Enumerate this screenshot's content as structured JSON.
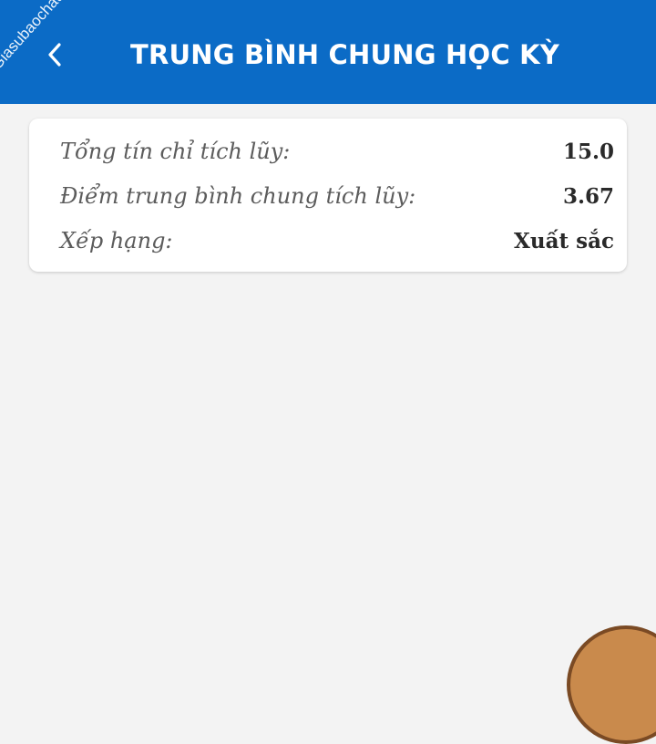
{
  "header": {
    "title": "TRUNG BÌNH CHUNG HỌC KỲ",
    "back_icon": "chevron-left-icon",
    "background": "#0b6bc6"
  },
  "watermark": {
    "text": "Giasubaochau.net"
  },
  "summary": {
    "rows": [
      {
        "label": "Tổng tín chỉ tích lũy:",
        "value": "15.0"
      },
      {
        "label": "Điểm trung bình chung tích lũy:",
        "value": "3.67"
      },
      {
        "label": "Xếp hạng:",
        "value": "Xuất sắc"
      }
    ]
  },
  "colors": {
    "page_background": "#f3f3f3",
    "card_background": "#ffffff",
    "label_text": "#5c5c5c",
    "value_text": "#2a2a2a"
  }
}
